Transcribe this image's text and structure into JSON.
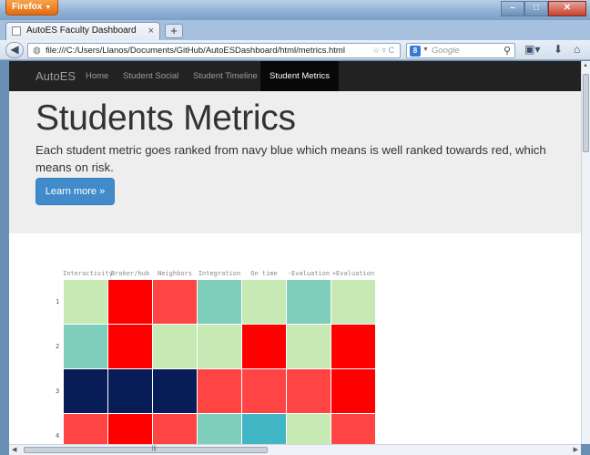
{
  "browser": {
    "menu_button": "Firefox",
    "tab_title": "AutoES Faculty Dashboard",
    "new_tab": "+",
    "url": "file:///C:/Users/Llanos/Documents/GitHub/AutoESDashboard/html/metrics.html",
    "search_engine": "8",
    "search_placeholder": "Google"
  },
  "site_nav": {
    "brand": "AutoES",
    "links": [
      {
        "label": "Home",
        "active": false
      },
      {
        "label": "Student Social",
        "active": false
      },
      {
        "label": "Student Timeline",
        "active": false
      },
      {
        "label": "Student Metrics",
        "active": true
      }
    ]
  },
  "jumbotron": {
    "title": "Students Metrics",
    "text": "Each student metric goes ranked from navy blue which means is well ranked towards red, which means on risk.",
    "button": "Learn more »"
  },
  "heatmap": {
    "columns": [
      "Interactivity",
      "Broker/hub",
      "Neighbors",
      "Integration",
      "On time",
      "-Evaluation",
      "+Evaluation"
    ],
    "rows": [
      "1",
      "2",
      "3",
      "4"
    ],
    "palette": {
      "light_green": "#c7e9b4",
      "teal": "#7fcdbb",
      "cyan": "#41b6c4",
      "navy": "#081d58",
      "light_red": "#ff4444",
      "red": "#ff0000"
    },
    "cells": [
      [
        "light_green",
        "red",
        "light_red",
        "teal",
        "light_green",
        "teal",
        "light_green"
      ],
      [
        "teal",
        "red",
        "light_green",
        "light_green",
        "red",
        "light_green",
        "red"
      ],
      [
        "navy",
        "navy",
        "navy",
        "light_red",
        "light_red",
        "light_red",
        "red"
      ],
      [
        "light_red",
        "red",
        "light_red",
        "teal",
        "cyan",
        "light_green",
        "light_red"
      ]
    ]
  }
}
